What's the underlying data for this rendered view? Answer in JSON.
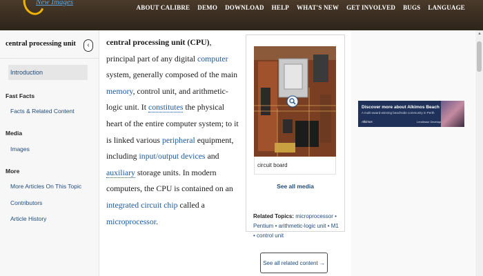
{
  "header": {
    "logo_text": "New Images",
    "nav": [
      "About Calibre",
      "Demo",
      "Download",
      "Help",
      "What's New",
      "Get Involved",
      "Bugs",
      "Language"
    ]
  },
  "sidebar": {
    "title": "central processing unit",
    "collapse_icon": "chevron-left-icon",
    "intro": "Introduction",
    "sections": [
      {
        "heading": "Fast Facts",
        "links": [
          "Facts & Related Content"
        ]
      },
      {
        "heading": "Media",
        "links": [
          "Images"
        ]
      },
      {
        "heading": "More",
        "links": [
          "More Articles On This Topic",
          "Contributors",
          "Article History"
        ]
      }
    ]
  },
  "article": {
    "term": "central processing unit (CPU)",
    "t1": ", principal part of any digital ",
    "l_computer": "computer",
    "t2": " system, generally composed of the main ",
    "l_memory": "memory",
    "t3": ", control unit, and arithmetic-logic unit. It ",
    "l_constitutes": "constitutes",
    "t4": " the physical heart of the entire computer system; to it is linked various ",
    "l_peripheral": "peripheral",
    "t5": " equipment, including ",
    "l_io": "input/output devices",
    "t6": " and ",
    "l_auxiliary": "auxiliary",
    "t7": " storage units. In modern computers, the CPU is contained on an ",
    "l_ic": "integrated circuit chip",
    "t8": " called a ",
    "l_micro": "microprocessor",
    "t9": "."
  },
  "media": {
    "caption": "circuit board",
    "see_all_media": "See all media",
    "zoom_icon": "magnifier-icon",
    "related_label": "Related Topics:",
    "related_topics": "microprocessor • Pentium • arithmetic-logic unit • M1 • control unit",
    "see_all_related": "See all related content →"
  },
  "ad": {
    "line1": "Discover more about Alkimos Beach",
    "line2": "A multi-award-winning beachside community in Perth",
    "line3": "Alkimos",
    "logos": "Lendlease  DevelopmentWA"
  }
}
